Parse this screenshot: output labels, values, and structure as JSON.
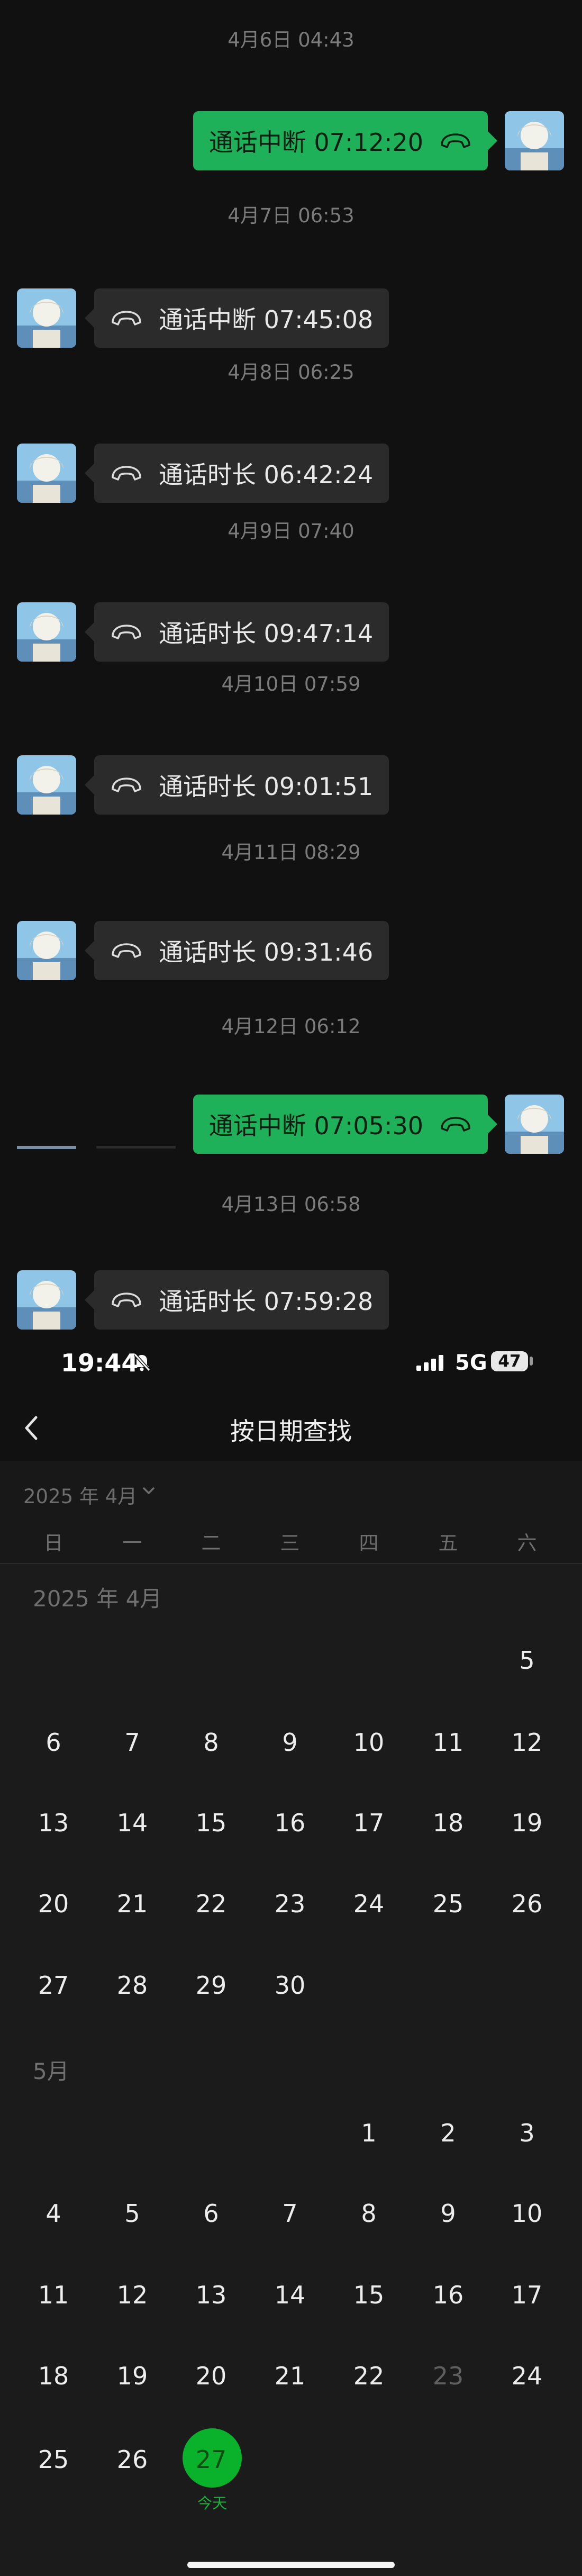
{
  "colors": {
    "background": "#111111",
    "bubble_in": "#2b2b2b",
    "bubble_out": "#1fb15a",
    "today": "#09b22a"
  },
  "chat": [
    {
      "timestamp": "4月6日 04:43",
      "direction": "out",
      "text": "通话中断 07:12:20"
    },
    {
      "timestamp": "4月7日 06:53",
      "direction": "in",
      "text": "通话中断 07:45:08"
    },
    {
      "timestamp": "4月8日 06:25",
      "direction": "in",
      "text": "通话时长 06:42:24"
    },
    {
      "timestamp": "4月9日 07:40",
      "direction": "in",
      "text": "通话时长 09:47:14"
    },
    {
      "timestamp": "4月10日 07:59",
      "direction": "in",
      "text": "通话时长 09:01:51"
    },
    {
      "timestamp": "4月11日 08:29",
      "direction": "in",
      "text": "通话时长 09:31:46"
    },
    {
      "timestamp": "4月12日 06:12",
      "direction": "out",
      "text": "通话中断 07:05:30"
    },
    {
      "timestamp": "4月13日 06:58",
      "direction": "in",
      "text": "通话时长 07:59:28"
    }
  ],
  "status": {
    "time": "19:44",
    "network": "5G",
    "battery": "47",
    "silent_icon": "bell-slash-icon",
    "signal_icon": "signal-bars-icon"
  },
  "header": {
    "title": "按日期查找",
    "back_icon": "chevron-left-icon"
  },
  "month_select": {
    "label": "2025 年 4月",
    "icon": "chevron-down-icon"
  },
  "weekdays": [
    "日",
    "一",
    "二",
    "三",
    "四",
    "五",
    "六"
  ],
  "calendar": {
    "april": {
      "label": "2025 年 4月",
      "rows": [
        [
          "",
          "",
          "",
          "",
          "",
          "",
          "5"
        ],
        [
          "6",
          "7",
          "8",
          "9",
          "10",
          "11",
          "12"
        ],
        [
          "13",
          "14",
          "15",
          "16",
          "17",
          "18",
          "19"
        ],
        [
          "20",
          "21",
          "22",
          "23",
          "24",
          "25",
          "26"
        ],
        [
          "27",
          "28",
          "29",
          "30",
          "",
          "",
          ""
        ]
      ]
    },
    "may": {
      "label": "5月",
      "rows": [
        [
          "",
          "",
          "",
          "",
          "1",
          "2",
          "3"
        ],
        [
          "4",
          "5",
          "6",
          "7",
          "8",
          "9",
          "10"
        ],
        [
          "11",
          "12",
          "13",
          "14",
          "15",
          "16",
          "17"
        ],
        [
          "18",
          "19",
          "20",
          "21",
          "22",
          "23",
          "24"
        ],
        [
          "25",
          "26",
          "27",
          "",
          "",
          "",
          ""
        ]
      ],
      "dimmed": [
        "23"
      ],
      "today": "27",
      "today_label": "今天"
    }
  }
}
